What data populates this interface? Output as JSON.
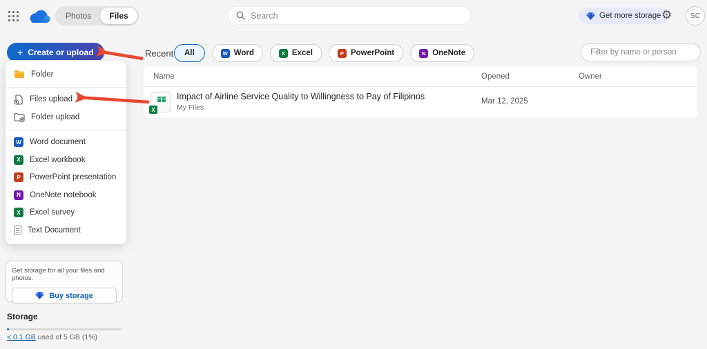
{
  "topbar": {
    "toggle": {
      "photos": "Photos",
      "files": "Files"
    },
    "search_placeholder": "Search",
    "get_more_storage": "Get more storage",
    "avatar_initials": "SC",
    "icons": [
      "app-launcher-icon",
      "onedrive-logo",
      "search-icon",
      "diamond-icon",
      "gear-icon"
    ]
  },
  "sidebar": {
    "create_button": "Create or upload",
    "menu": {
      "items": [
        {
          "label": "Folder",
          "icon": "folder-icon"
        },
        {
          "label": "Files upload",
          "icon": "file-upload-icon"
        },
        {
          "label": "Folder upload",
          "icon": "folder-upload-icon"
        },
        {
          "label": "Word document",
          "icon": "word-icon",
          "badge": "W",
          "color": "#185abd"
        },
        {
          "label": "Excel workbook",
          "icon": "excel-icon",
          "badge": "X",
          "color": "#107c41"
        },
        {
          "label": "PowerPoint presentation",
          "icon": "powerpoint-icon",
          "badge": "P",
          "color": "#c43e1c"
        },
        {
          "label": "OneNote notebook",
          "icon": "onenote-icon",
          "badge": "N",
          "color": "#7719aa"
        },
        {
          "label": "Excel survey",
          "icon": "excel-survey-icon",
          "badge": "X",
          "color": "#0f7b3f"
        },
        {
          "label": "Text Document",
          "icon": "text-document-icon"
        }
      ]
    },
    "storage_promo": {
      "text": "Get storage for all your files and photos.",
      "button": "Buy storage"
    },
    "storage": {
      "heading": "Storage",
      "used_link": "< 0.1 GB",
      "usage_rest": " used of 5 GB (1%)",
      "percent_used": 1
    }
  },
  "main": {
    "recent_label": "Recent",
    "filters": [
      {
        "label": "All",
        "active": true
      },
      {
        "label": "Word",
        "badge": "W",
        "color": "#185abd"
      },
      {
        "label": "Excel",
        "badge": "X",
        "color": "#107c41"
      },
      {
        "label": "PowerPoint",
        "badge": "P",
        "color": "#c43e1c"
      },
      {
        "label": "OneNote",
        "badge": "N",
        "color": "#7719aa"
      }
    ],
    "filter_placeholder": "Filter by name or person",
    "table": {
      "columns": [
        "Name",
        "Opened",
        "Owner"
      ],
      "rows": [
        {
          "name": "Impact of Airline Service Quality to Willingness to Pay of Filipinos",
          "location": "My Files",
          "opened": "Mar 12, 2025",
          "owner": "",
          "file_type": "excel"
        }
      ]
    }
  },
  "annotations": {
    "arrow_color": "#e8472f",
    "arrows": [
      "arrow-to-create-button",
      "arrow-to-files-upload"
    ]
  },
  "colors": {
    "accent": "#0f6cbd",
    "create_gradient": [
      "#0e6acd",
      "#4a44ad"
    ]
  }
}
